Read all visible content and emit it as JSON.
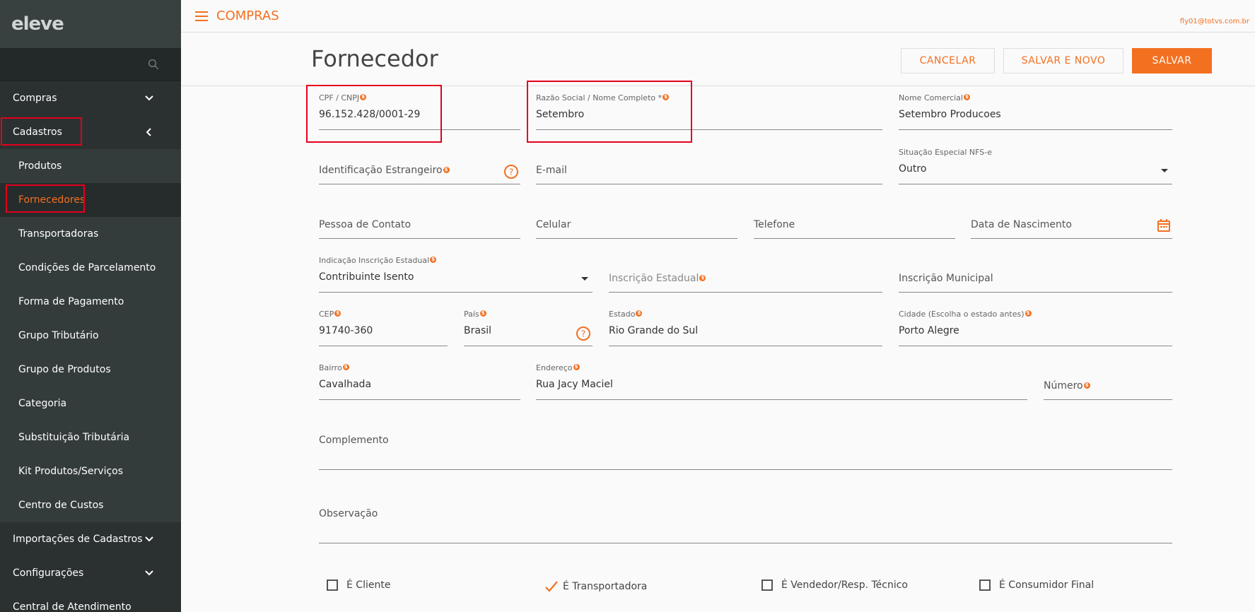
{
  "sidebar": {
    "logo": "eleve",
    "items": [
      {
        "label": "Compras"
      },
      {
        "label": "Cadastros"
      }
    ],
    "sub_items": [
      {
        "label": "Produtos"
      },
      {
        "label": "Fornecedores"
      },
      {
        "label": "Transportadoras"
      },
      {
        "label": "Condições de Parcelamento"
      },
      {
        "label": "Forma de Pagamento"
      },
      {
        "label": "Grupo Tributário"
      },
      {
        "label": "Grupo de Produtos"
      },
      {
        "label": "Categoria"
      },
      {
        "label": "Substituição Tributária"
      },
      {
        "label": "Kit Produtos/Serviços"
      },
      {
        "label": "Centro de Custos"
      }
    ],
    "bottom_items": [
      {
        "label": "Importações de Cadastros"
      },
      {
        "label": "Configurações"
      },
      {
        "label": "Central de Atendimento"
      }
    ]
  },
  "topbar": {
    "module": "COMPRAS",
    "user_email": "fly01@totvs.com.br"
  },
  "page": {
    "title": "Fornecedor",
    "buttons": {
      "cancel": "CANCELAR",
      "save_new": "SALVAR E NOVO",
      "save": "SALVAR"
    }
  },
  "form": {
    "cpf_cnpj": {
      "label": "CPF / CNPJ",
      "value": "96.152.428/0001-29"
    },
    "razao_social": {
      "label": "Razão Social / Nome Completo *",
      "value": "Setembro"
    },
    "nome_comercial": {
      "label": "Nome Comercial",
      "value": "Setembro Producoes"
    },
    "identificacao_estrangeiro": {
      "placeholder": "Identificação Estrangeiro"
    },
    "email": {
      "placeholder": "E-mail"
    },
    "situacao_nfse": {
      "label": "Situação Especial NFS-e",
      "value": "Outro"
    },
    "pessoa_contato": {
      "placeholder": "Pessoa de Contato"
    },
    "celular": {
      "placeholder": "Celular"
    },
    "telefone": {
      "placeholder": "Telefone"
    },
    "data_nascimento": {
      "placeholder": "Data de Nascimento"
    },
    "indicacao_ie": {
      "label": "Indicação Inscrição Estadual",
      "value": "Contribuinte Isento"
    },
    "inscricao_estadual": {
      "placeholder": "Inscrição Estadual"
    },
    "inscricao_municipal": {
      "placeholder": "Inscrição Municipal"
    },
    "cep": {
      "label": "CEP",
      "value": "91740-360"
    },
    "pais": {
      "label": "País",
      "value": "Brasil"
    },
    "estado": {
      "label": "Estado",
      "value": "Rio Grande do Sul"
    },
    "cidade": {
      "label": "Cidade (Escolha o estado antes)",
      "value": "Porto Alegre"
    },
    "bairro": {
      "label": "Bairro",
      "value": "Cavalhada"
    },
    "endereco": {
      "label": "Endereço",
      "value": "Rua Jacy Maciel"
    },
    "numero": {
      "placeholder": "Número"
    },
    "complemento": {
      "placeholder": "Complemento"
    },
    "observacao": {
      "placeholder": "Observação"
    },
    "checkboxes": [
      {
        "label": "É Cliente",
        "checked": false
      },
      {
        "label": "É Transportadora",
        "checked": true
      },
      {
        "label": "É Vendedor/Resp. Técnico",
        "checked": false
      },
      {
        "label": "É Consumidor Final",
        "checked": false
      }
    ]
  },
  "colors": {
    "accent": "#f37021",
    "sidebar_bg": "#2b3131",
    "highlight_box": "#e4001b"
  }
}
